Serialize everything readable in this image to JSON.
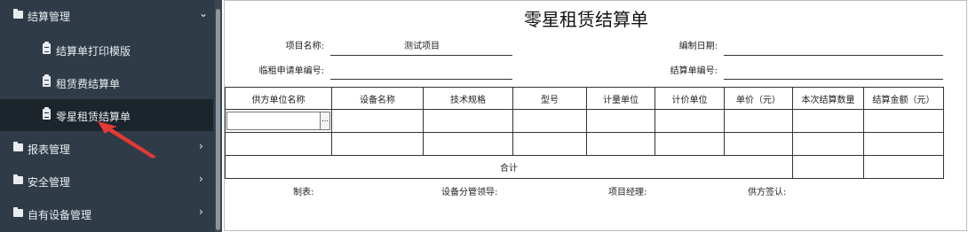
{
  "sidebar": {
    "groups": [
      {
        "label": "结算管理",
        "expanded": true
      },
      {
        "label": "报表管理"
      },
      {
        "label": "安全管理"
      },
      {
        "label": "自有设备管理"
      }
    ],
    "items": [
      {
        "label": "结算单打印模版"
      },
      {
        "label": "租赁费结算单"
      },
      {
        "label": "零星租赁结算单",
        "active": true
      }
    ],
    "icons": {
      "folder": "folder-icon",
      "clipboard": "clipboard-icon",
      "chevron": "chevron-icon"
    }
  },
  "form": {
    "title": "零星租赁结算单",
    "project_name_label": "项目名称:",
    "project_name_value": "测试项目",
    "date_label": "编制日期:",
    "date_value": "",
    "request_no_label": "临租申请单编号:",
    "request_no_value": "",
    "settlement_no_label": "结算单编号:",
    "settlement_no_value": ""
  },
  "table": {
    "headers": [
      "供方单位名称",
      "设备名称",
      "技术规格",
      "型号",
      "计量单位",
      "计价单位",
      "单价（元）",
      "本次结算数量",
      "结算金额（元）"
    ],
    "picker_button": "...",
    "total_label": "合计"
  },
  "footer": {
    "maker_label": "制表:",
    "equipment_leader_label": "设备分管领导:",
    "project_manager_label": "项目经理:",
    "supplier_sign_label": "供方签认:"
  },
  "colors": {
    "sidebar_bg": "#2f3c48",
    "active_bg": "#1c242c",
    "arrow": "#e53935"
  }
}
